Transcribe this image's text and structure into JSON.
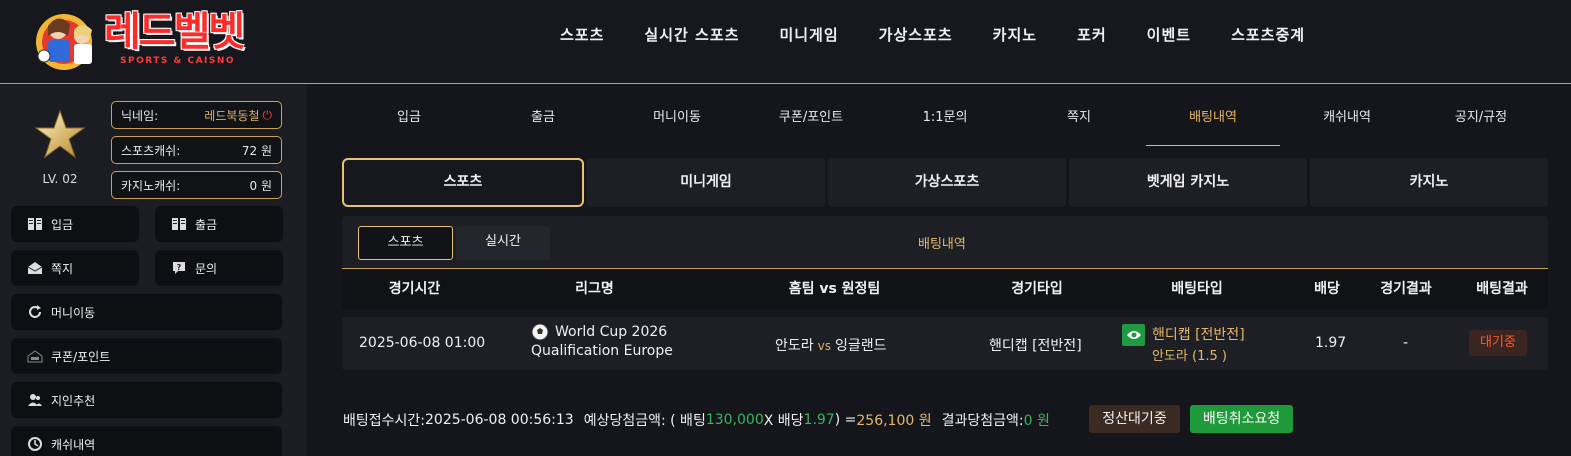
{
  "header": {
    "logo_text": "레드벨벳",
    "logo_sub": "SPORTS & CAISNO",
    "nav": [
      "스포츠",
      "실시간 스포츠",
      "미니게임",
      "가상스포츠",
      "카지노",
      "포커",
      "이벤트",
      "스포츠중계"
    ]
  },
  "sidebar": {
    "level": "LV. 02",
    "nickname_label": "닉네임:",
    "nickname_value": "레드북동철",
    "sports_cash_label": "스포츠캐쉬:",
    "sports_cash_value": "72 원",
    "casino_cash_label": "카지노캐쉬:",
    "casino_cash_value": "0 원",
    "buttons": {
      "deposit": "입금",
      "withdraw": "출금",
      "message": "쪽지",
      "inquiry": "문의",
      "money_transfer": "머니이동",
      "coupon_point": "쿠폰/포인트",
      "referral": "지인추천",
      "cash_history": "캐쉬내역"
    }
  },
  "main_tabs": [
    "입금",
    "출금",
    "머니이동",
    "쿠폰/포인트",
    "1:1문의",
    "쪽지",
    "배팅내역",
    "캐쉬내역",
    "공지/규정"
  ],
  "game_tabs": [
    "스포츠",
    "미니게임",
    "가상스포츠",
    "벳게임 카지노",
    "카지노"
  ],
  "sub_tabs": {
    "sports": "스포츠",
    "live": "실시간",
    "title": "배팅내역"
  },
  "table": {
    "headers": [
      "경기시간",
      "리그명",
      "홈팀 vs 원정팀",
      "경기타입",
      "배팅타입",
      "배당",
      "경기결과",
      "배팅결과"
    ],
    "row": {
      "time": "2025-06-08 01:00",
      "league_line1": "World Cup 2026",
      "league_line2": "Qualification Europe",
      "home": "안도라",
      "vs": "vs",
      "away": "잉글랜드",
      "game_type": "핸디캡 [전반전]",
      "bet_type_line1": "핸디캡 [전반전]",
      "bet_type_line2": "안도라 (1.5 )",
      "odds": "1.97",
      "game_result": "-",
      "bet_result": "대기중"
    }
  },
  "footer": {
    "received_label": "배팅접수시간: ",
    "received_value": "2025-06-08 00:56:13",
    "expected_label": "예상당첨금액: ( 배팅 ",
    "bet_amount": "130,000",
    "x_label": " X 배당 ",
    "odds": "1.97",
    "eq": " ) = ",
    "expected_value": "256,100 원",
    "result_label": "결과당첨금액: ",
    "result_value": "0 원",
    "settle_button": "정산대기중",
    "cancel_button": "배팅취소요청"
  },
  "colors": {
    "accent_gold": "#e6b766",
    "green": "#1f9a3a",
    "pending_red": "#ff5a2a"
  }
}
